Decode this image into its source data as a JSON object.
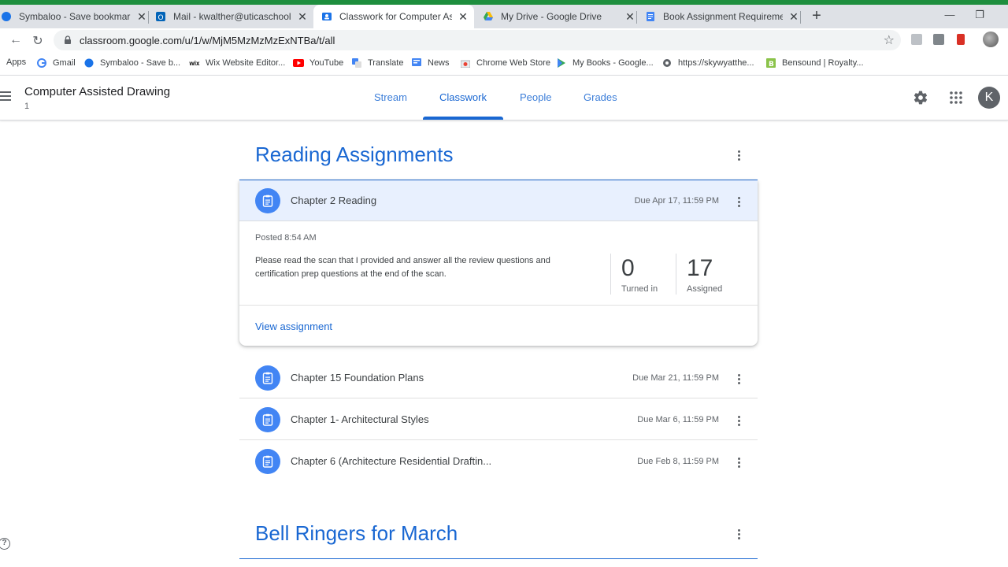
{
  "browser": {
    "tabs": [
      {
        "title": "Symbaloo - Save bookmarks and",
        "close": "✕"
      },
      {
        "title": "Mail - kwalther@uticaschools.org",
        "close": "✕"
      },
      {
        "title": "Classwork for Computer Assisted",
        "close": "✕"
      },
      {
        "title": "My Drive - Google Drive",
        "close": "✕"
      },
      {
        "title": "Book Assignment Requirements",
        "close": "✕"
      }
    ],
    "new_tab": "+",
    "minimize": "—",
    "restore": "❐",
    "url": "classroom.google.com/u/1/w/MjM5MzMzMzExNTBa/t/all",
    "back": "←",
    "forward": "→",
    "reload": "↻",
    "star": "☆",
    "bookmarks": [
      {
        "label": "Apps"
      },
      {
        "label": "Gmail"
      },
      {
        "label": "Symbaloo - Save b..."
      },
      {
        "label": "Wix Website Editor..."
      },
      {
        "label": "YouTube"
      },
      {
        "label": "Translate"
      },
      {
        "label": "News"
      },
      {
        "label": "Chrome Web Store"
      },
      {
        "label": "My Books - Google..."
      },
      {
        "label": "https://skywyatthe..."
      },
      {
        "label": "Bensound | Royalty..."
      }
    ]
  },
  "classroom": {
    "class_name": "Computer Assisted Drawing",
    "class_section": "1",
    "nav": [
      "Stream",
      "Classwork",
      "People",
      "Grades"
    ],
    "avatar_letter": "K",
    "topics": [
      {
        "title": "Reading Assignments",
        "expanded": {
          "title": "Chapter 2 Reading",
          "due": "Due Apr 17, 11:59 PM",
          "posted": "Posted 8:54 AM",
          "description": "Please read the scan that I provided and answer all the review questions and certification prep questions at the end of the scan.",
          "turned_in": "0",
          "turned_in_label": "Turned in",
          "assigned": "17",
          "assigned_label": "Assigned",
          "view_link": "View assignment"
        },
        "items": [
          {
            "title": "Chapter 15 Foundation Plans",
            "due": "Due Mar 21, 11:59 PM"
          },
          {
            "title": "Chapter 1- Architectural Styles",
            "due": "Due Mar 6, 11:59 PM"
          },
          {
            "title": "Chapter 6 (Architecture Residential Draftin...",
            "due": "Due Feb 8, 11:59 PM"
          }
        ]
      },
      {
        "title": "Bell Ringers for March"
      }
    ],
    "help": "?"
  },
  "colors": {
    "accent": "#1967d2",
    "assignment_icon": "#4285f4",
    "avatar": "#5f6368",
    "selected_row": "#e8f0fe"
  }
}
